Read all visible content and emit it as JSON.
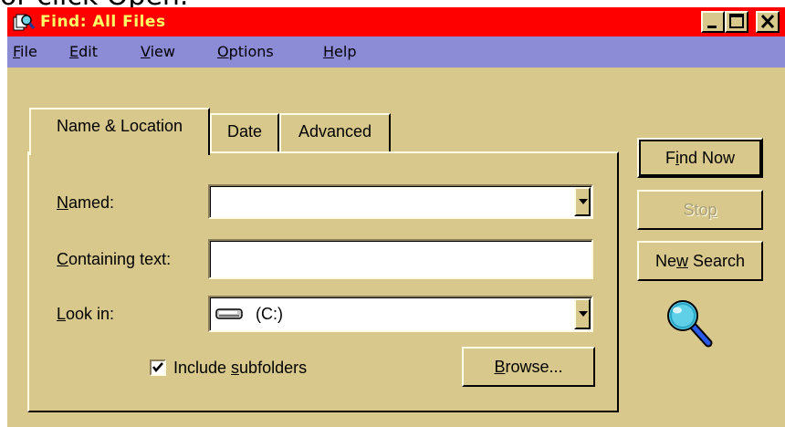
{
  "caption_fragment": "or click Open.",
  "window": {
    "title": "Find: All Files",
    "controls": {
      "minimize": "minimize-icon",
      "maximize": "maximize-icon",
      "close": "close-icon"
    }
  },
  "menu": [
    {
      "pre": "",
      "ul": "F",
      "post": "ile"
    },
    {
      "pre": "",
      "ul": "E",
      "post": "dit"
    },
    {
      "pre": "",
      "ul": "V",
      "post": "iew"
    },
    {
      "pre": "",
      "ul": "O",
      "post": "ptions"
    },
    {
      "pre": "",
      "ul": "H",
      "post": "elp"
    }
  ],
  "tabs": {
    "name_location": "Name & Location",
    "date": "Date",
    "advanced": "Advanced",
    "active": "name_location"
  },
  "form": {
    "named": {
      "pre": "",
      "ul": "N",
      "post": "amed:",
      "value": ""
    },
    "containing": {
      "pre": "",
      "ul": "C",
      "post": "ontaining text:",
      "value": ""
    },
    "look_in": {
      "pre": "",
      "ul": "L",
      "post": "ook in:",
      "value": "(C:)",
      "icon": "drive-icon"
    },
    "include_subfolders": {
      "pre": "Include ",
      "ul": "s",
      "post": "ubfolders",
      "checked": true
    },
    "browse": {
      "pre": "",
      "ul": "B",
      "post": "rowse..."
    }
  },
  "buttons": {
    "find_now": {
      "pre": "F",
      "ul": "i",
      "post": "nd Now"
    },
    "stop": {
      "pre": "Sto",
      "ul": "p",
      "post": ""
    },
    "new_search": {
      "pre": "Ne",
      "ul": "w",
      "post": " Search"
    }
  },
  "colors": {
    "titlebar": "#ff0000",
    "title_text": "#ffff66",
    "menubar": "#8b8bd6",
    "face": "#d8c88c"
  },
  "decor": {
    "magnifier": "magnifier-icon"
  }
}
